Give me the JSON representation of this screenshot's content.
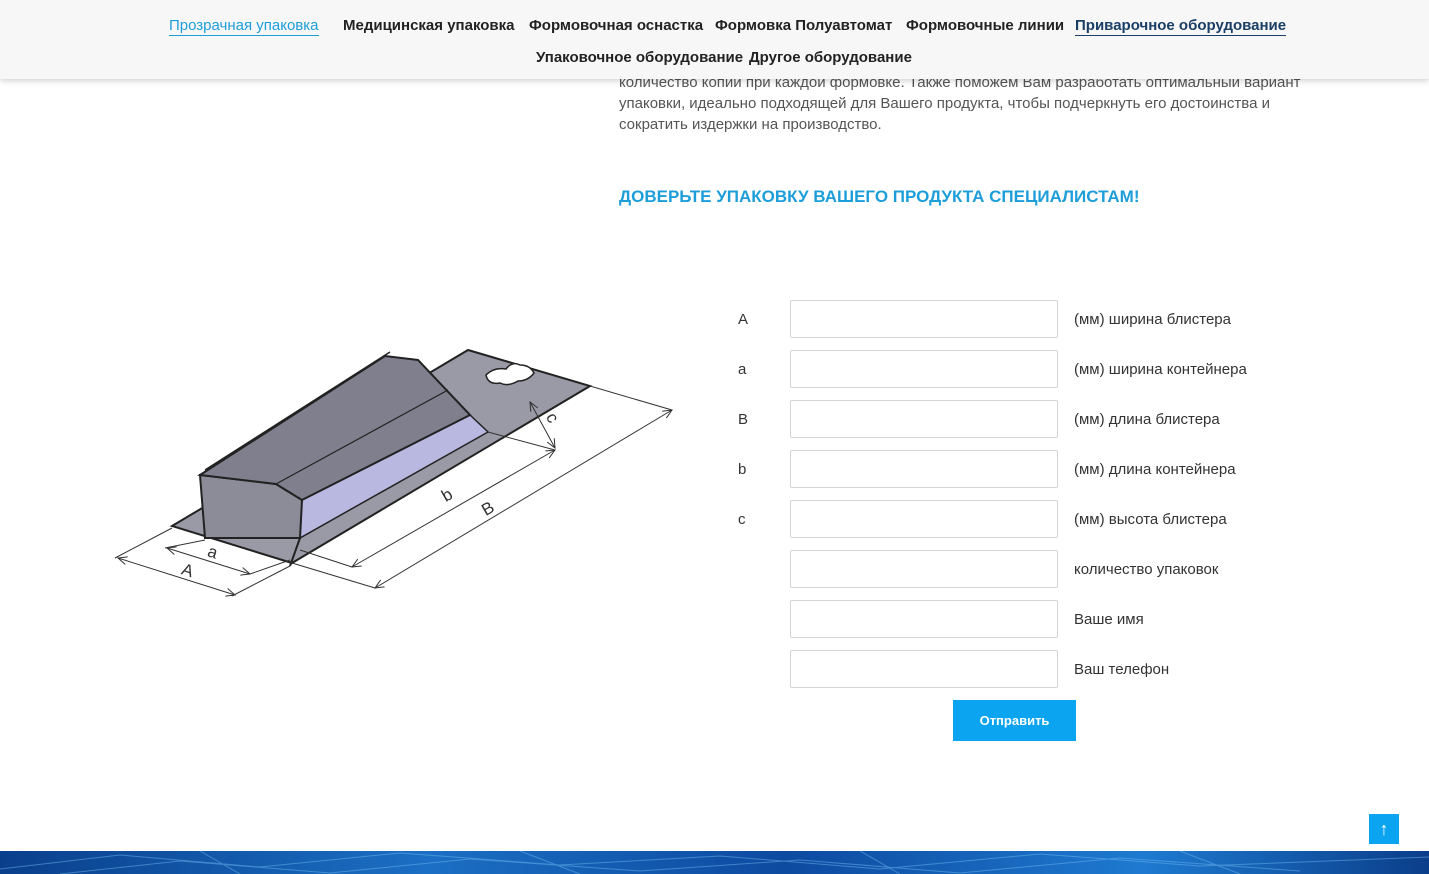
{
  "nav": {
    "items": [
      {
        "label": "Прозрачная упаковка"
      },
      {
        "label": "Медицинская упаковка"
      },
      {
        "label": "Формовочная оснастка"
      },
      {
        "label": "Формовка Полуавтомат"
      },
      {
        "label": "Формовочные линии"
      },
      {
        "label": "Приварочное оборудование"
      },
      {
        "label": "Упаковочное оборудование"
      },
      {
        "label": "Другое оборудование"
      }
    ]
  },
  "intro": {
    "text": "количество копий при каждой формовке. Также поможем Вам разработать оптимальный вариант упаковки, идеально подходящей для Вашего продукта, чтобы подчеркнуть его достоинства и сократить издержки на производство."
  },
  "headline": "ДОВЕРЬТЕ УПАКОВКУ ВАШЕГО ПРОДУКТА СПЕЦИАЛИСТАМ!",
  "diagram": {
    "labels": {
      "A": "A",
      "a": "a",
      "B": "B",
      "b": "b",
      "c": "c"
    }
  },
  "form": {
    "rows": [
      {
        "letter": "A",
        "value": "",
        "label": "(мм) ширина блистера"
      },
      {
        "letter": "a",
        "value": "",
        "label": "(мм) ширина контейнера"
      },
      {
        "letter": "B",
        "value": "",
        "label": "(мм) длина блистера"
      },
      {
        "letter": "b",
        "value": "",
        "label": "(мм) длина контейнера"
      },
      {
        "letter": "c",
        "value": "",
        "label": "(мм) высота блистера"
      },
      {
        "letter": "",
        "value": "",
        "label": "количество упаковок"
      },
      {
        "letter": "",
        "value": "",
        "label": "Ваше имя"
      },
      {
        "letter": "",
        "value": "",
        "label": "Ваш телефон"
      }
    ],
    "submit_label": "Отправить"
  },
  "scroll_top_icon": "↑",
  "colors": {
    "accent": "#0aa4f0",
    "link": "#1e9ed9",
    "nav_bg": "#f7f7f7"
  }
}
